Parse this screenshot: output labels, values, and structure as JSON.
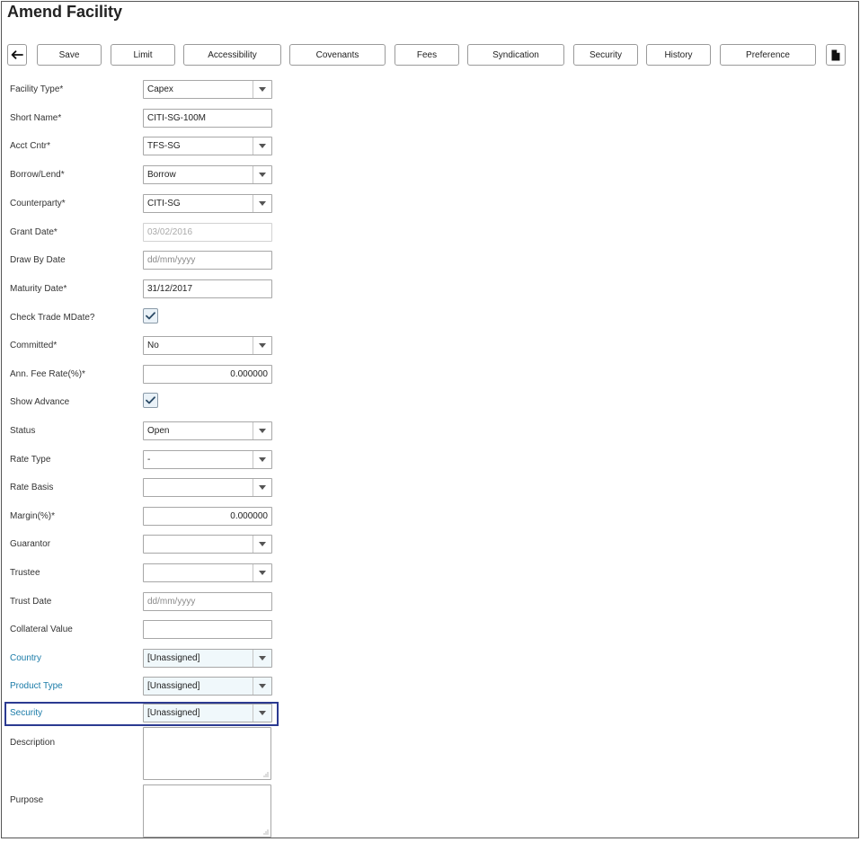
{
  "page": {
    "title": "Amend Facility"
  },
  "toolbar": {
    "back_icon": "arrow-left-icon",
    "buttons": [
      "Save",
      "Limit",
      "Accessibility",
      "Covenants",
      "Fees",
      "Syndication",
      "Security",
      "History",
      "Preference"
    ],
    "document_icon": "document-icon"
  },
  "form": {
    "facility_type": {
      "label": "Facility Type*",
      "value": "Capex"
    },
    "short_name": {
      "label": "Short Name*",
      "value": "CITI-SG-100M"
    },
    "acct_cntr": {
      "label": "Acct Cntr*",
      "value": "TFS-SG"
    },
    "borrow_lend": {
      "label": "Borrow/Lend*",
      "value": "Borrow"
    },
    "counterparty": {
      "label": "Counterparty*",
      "value": "CITI-SG"
    },
    "grant_date": {
      "label": "Grant Date*",
      "value": "03/02/2016"
    },
    "draw_by_date": {
      "label": "Draw By Date",
      "placeholder": "dd/mm/yyyy"
    },
    "maturity_date": {
      "label": "Maturity Date*",
      "value": "31/12/2017"
    },
    "check_trade_mdate": {
      "label": "Check Trade MDate?",
      "checked": true
    },
    "committed": {
      "label": "Committed*",
      "value": "No"
    },
    "ann_fee_rate": {
      "label": "Ann. Fee Rate(%)*",
      "value": "0.000000"
    },
    "show_advance": {
      "label": "Show Advance",
      "checked": true
    },
    "status": {
      "label": "Status",
      "value": "Open"
    },
    "rate_type": {
      "label": "Rate Type",
      "value": "-"
    },
    "rate_basis": {
      "label": "Rate Basis",
      "value": ""
    },
    "margin": {
      "label": "Margin(%)*",
      "value": "0.000000"
    },
    "guarantor": {
      "label": "Guarantor",
      "value": ""
    },
    "trustee": {
      "label": "Trustee",
      "value": ""
    },
    "trust_date": {
      "label": "Trust Date",
      "placeholder": "dd/mm/yyyy"
    },
    "collateral_value": {
      "label": "Collateral Value",
      "value": ""
    },
    "country": {
      "label": "Country",
      "value": "[Unassigned]"
    },
    "product_type": {
      "label": "Product Type",
      "value": "[Unassigned]"
    },
    "security": {
      "label": "Security",
      "value": "[Unassigned]"
    },
    "description": {
      "label": "Description",
      "value": ""
    },
    "purpose": {
      "label": "Purpose",
      "value": ""
    }
  },
  "colors": {
    "link_label": "#1a7ba8",
    "highlight": "#2b3a91",
    "checkbox_bg": "#eaf2f8"
  }
}
